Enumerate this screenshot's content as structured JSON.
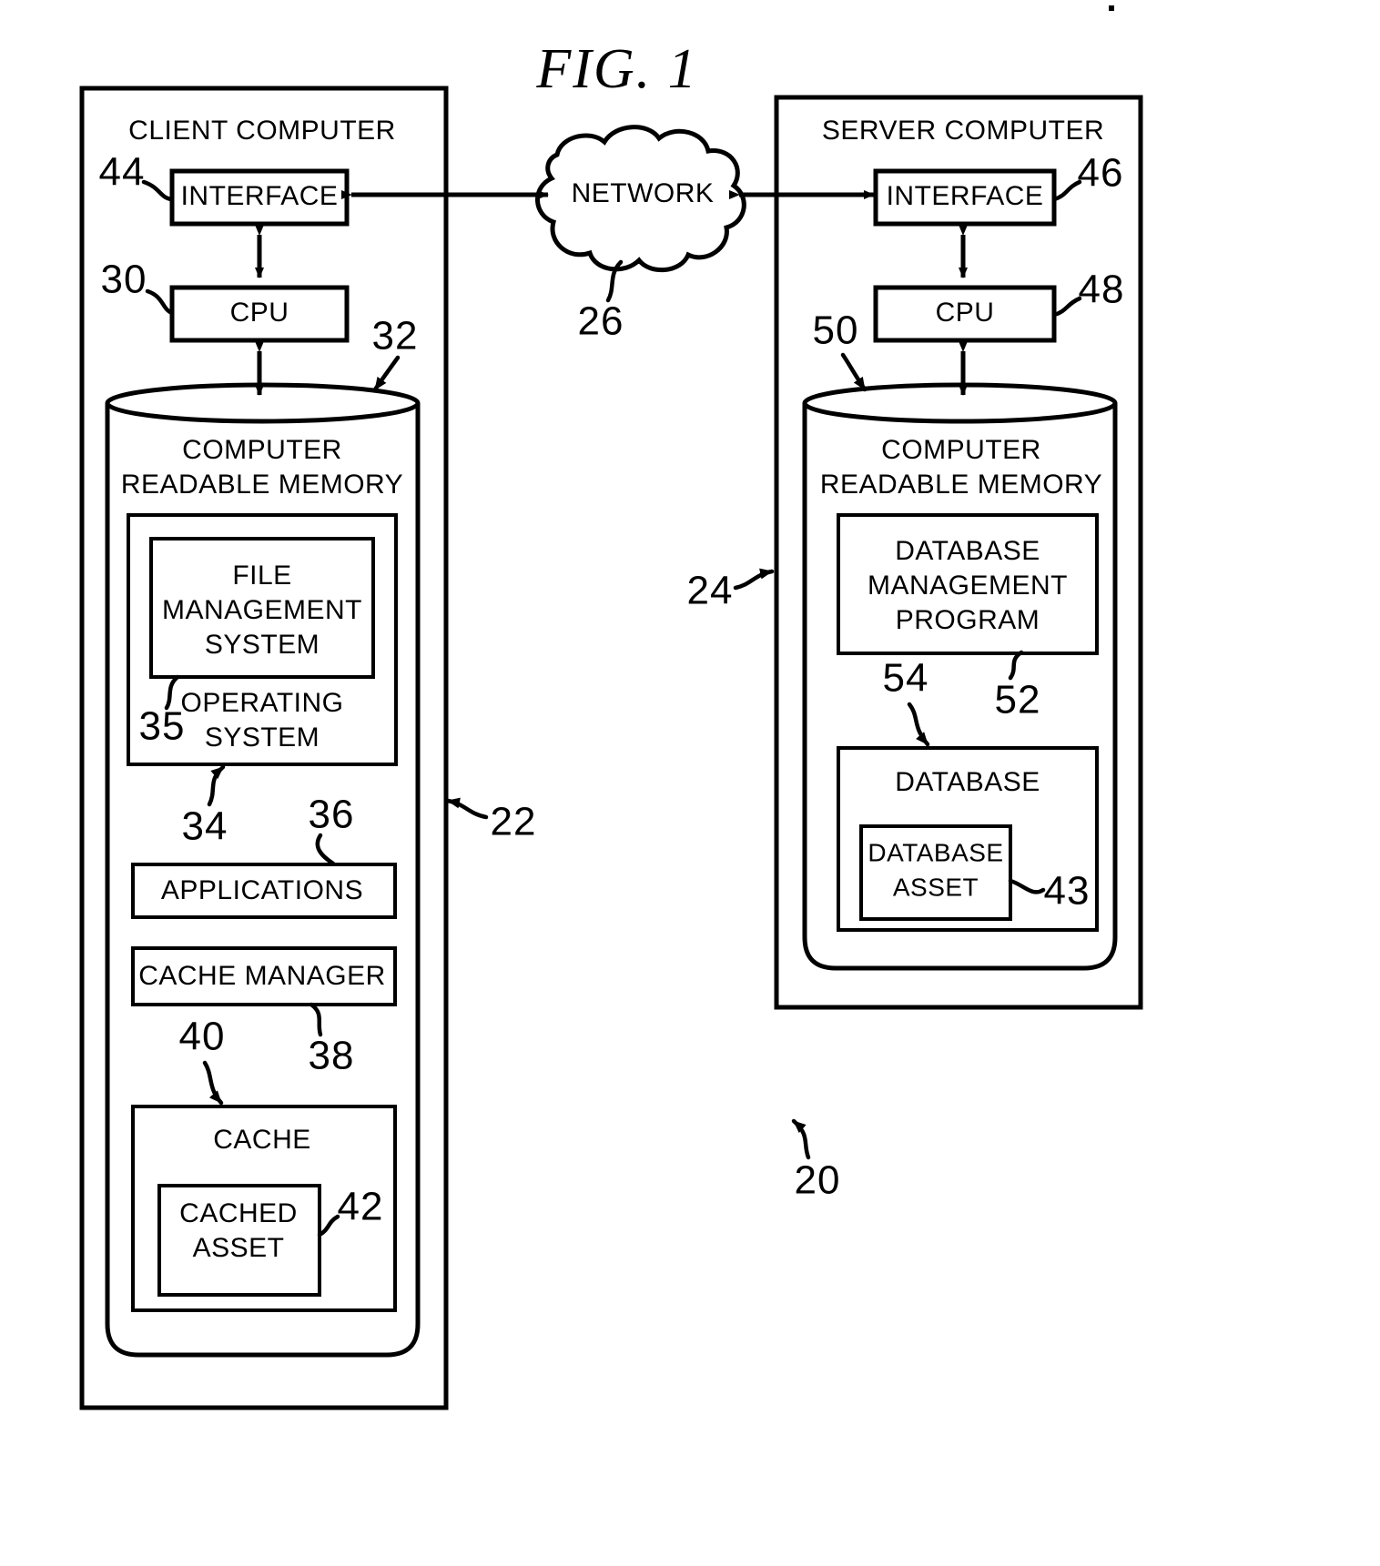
{
  "figure": {
    "title": "FIG.  1",
    "overall_ref": "20"
  },
  "network": {
    "label": "NETWORK",
    "ref": "26"
  },
  "client": {
    "title": "CLIENT COMPUTER",
    "ref": "22",
    "interface": {
      "label": "INTERFACE",
      "ref": "44"
    },
    "cpu": {
      "label": "CPU",
      "ref": "30"
    },
    "memory": {
      "line1": "COMPUTER",
      "line2": "READABLE  MEMORY",
      "ref": "32"
    },
    "operating_system": {
      "line1": "OPERATING",
      "line2": "SYSTEM",
      "ref": "34"
    },
    "file_management_system": {
      "line1": "FILE",
      "line2": "MANAGEMENT",
      "line3": "SYSTEM",
      "ref": "35"
    },
    "applications": {
      "label": "APPLICATIONS",
      "ref": "36"
    },
    "cache_manager": {
      "label": "CACHE  MANAGER",
      "ref": "38"
    },
    "cache": {
      "label": "CACHE",
      "ref": "40"
    },
    "cached_asset": {
      "line1": "CACHED",
      "line2": "ASSET",
      "ref": "42"
    }
  },
  "server": {
    "title": "SERVER COMPUTER",
    "ref": "24",
    "interface": {
      "label": "INTERFACE",
      "ref": "46"
    },
    "cpu": {
      "label": "CPU",
      "ref": "48"
    },
    "memory": {
      "line1": "COMPUTER",
      "line2": "READABLE  MEMORY",
      "ref": "50"
    },
    "database_management_program": {
      "line1": "DATABASE",
      "line2": "MANAGEMENT",
      "line3": "PROGRAM",
      "ref": "52"
    },
    "database": {
      "label": "DATABASE",
      "ref": "54"
    },
    "database_asset": {
      "line1": "DATABASE",
      "line2": "ASSET",
      "ref": "43"
    }
  },
  "colors": {
    "ink": "#000000",
    "paper": "#ffffff"
  }
}
